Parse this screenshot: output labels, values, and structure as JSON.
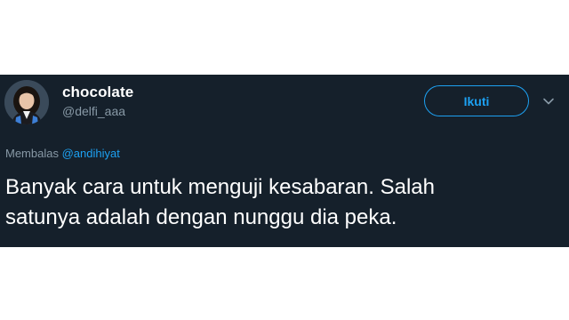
{
  "tweet": {
    "display_name": "chocolate",
    "handle": "@delfi_aaa",
    "follow_label": "Ikuti",
    "reply_prefix": "Membalas",
    "reply_mention": "@andihiyat",
    "text_line1": "Banyak cara untuk menguji kesabaran. Salah",
    "text_line2": "satunya adalah dengan nunggu dia peka."
  },
  "icons": {
    "avatar": "profile-photo",
    "menu": "chevron-down-icon"
  },
  "colors": {
    "background": "#15202b",
    "accent": "#1da1f2",
    "secondary_text": "#8899a6",
    "primary_text": "#ffffff"
  }
}
